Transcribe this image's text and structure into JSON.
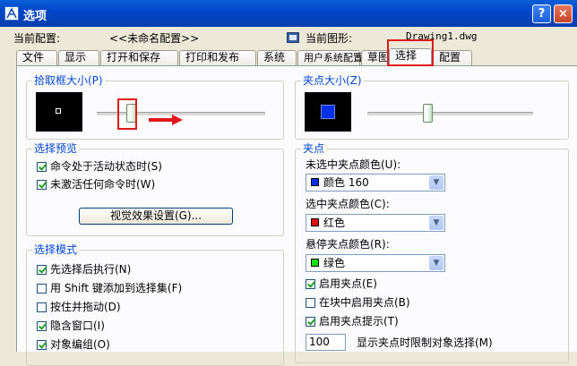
{
  "title": "选项",
  "title_buttons": {
    "help": "?",
    "close": "×"
  },
  "info": {
    "config_label": "当前配置:",
    "config_value": "<<未命名配置>>",
    "drawing_label": "当前图形:",
    "drawing_value": "Drawing1.dwg"
  },
  "tabs": [
    "文件",
    "显示",
    "打开和保存",
    "打印和发布",
    "系统",
    "用户系统配置",
    "草图",
    "选择",
    "配置"
  ],
  "active_tab": "选择",
  "pickbox": {
    "title": "拾取框大小(P)",
    "level": 0.2
  },
  "grip_size": {
    "title": "夹点大小(Z)",
    "level": 0.36
  },
  "selection_preview": {
    "title": "选择预览",
    "items": [
      {
        "label": "命令处于活动状态时(S)",
        "checked": true
      },
      {
        "label": "未激活任何命令时(W)",
        "checked": true
      }
    ],
    "button": "视觉效果设置(G)..."
  },
  "selection_mode": {
    "title": "选择模式",
    "items": [
      {
        "label": "先选择后执行(N)",
        "checked": true
      },
      {
        "label": "用 Shift 键添加到选择集(F)",
        "checked": false
      },
      {
        "label": "按住并拖动(D)",
        "checked": false
      },
      {
        "label": "隐含窗口(I)",
        "checked": true
      },
      {
        "label": "对象编组(O)",
        "checked": true
      }
    ]
  },
  "grips": {
    "title": "夹点",
    "unselected_label": "未选中夹点颜色(U):",
    "unselected_value": "颜色 160",
    "unselected_color": "#0030e8",
    "selected_label": "选中夹点颜色(C):",
    "selected_value": "红色",
    "selected_color": "#e01010",
    "hover_label": "悬停夹点颜色(R):",
    "hover_value": "绿色",
    "hover_color": "#10e010",
    "checks": [
      {
        "label": "启用夹点(E)",
        "checked": true
      },
      {
        "label": "在块中启用夹点(B)",
        "checked": false
      },
      {
        "label": "启用夹点提示(T)",
        "checked": true
      }
    ],
    "limit_value": "100",
    "limit_label": "显示夹点时限制对象选择(M)"
  },
  "colors": {
    "highlight_box": "#e0191d",
    "arrow": "#e0191d",
    "group_title": "#0046d5"
  }
}
